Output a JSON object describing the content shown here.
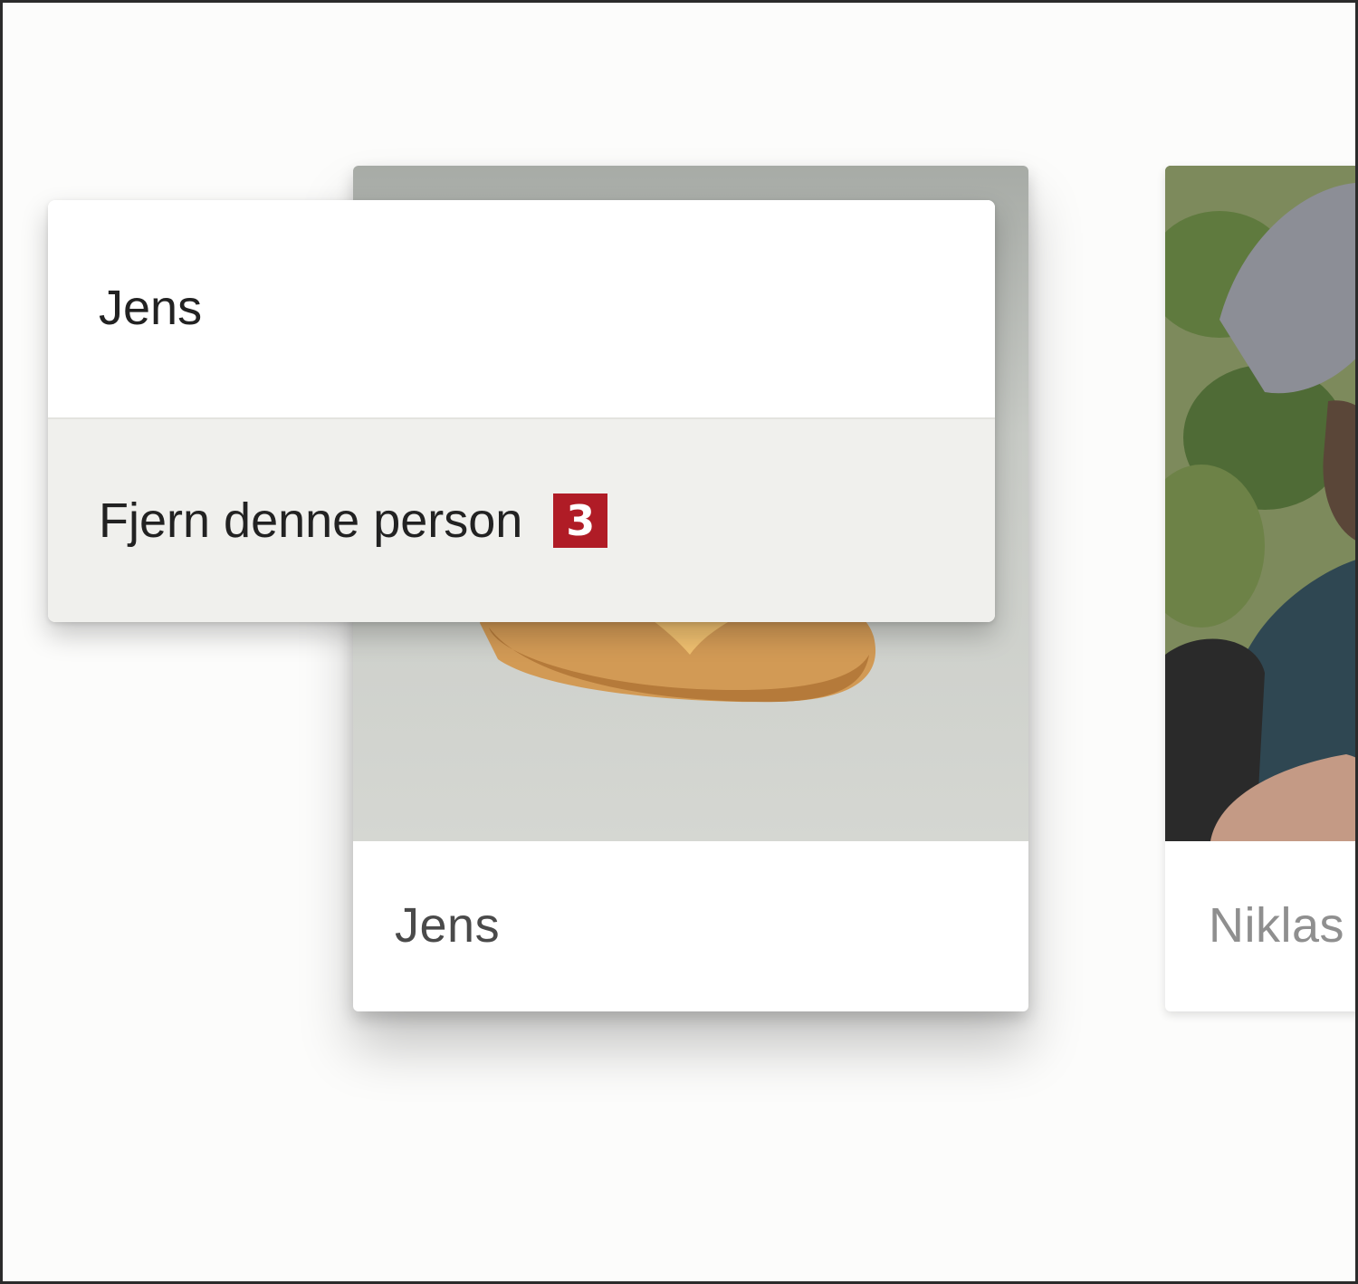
{
  "context_menu": {
    "header_label": "Jens",
    "remove_label": "Fjern denne person",
    "step_badge": "3"
  },
  "cards": [
    {
      "name": "Jens"
    },
    {
      "name": "Niklas"
    }
  ],
  "colors": {
    "badge": "#b01c26",
    "menu_hover": "#f0f0ed"
  }
}
